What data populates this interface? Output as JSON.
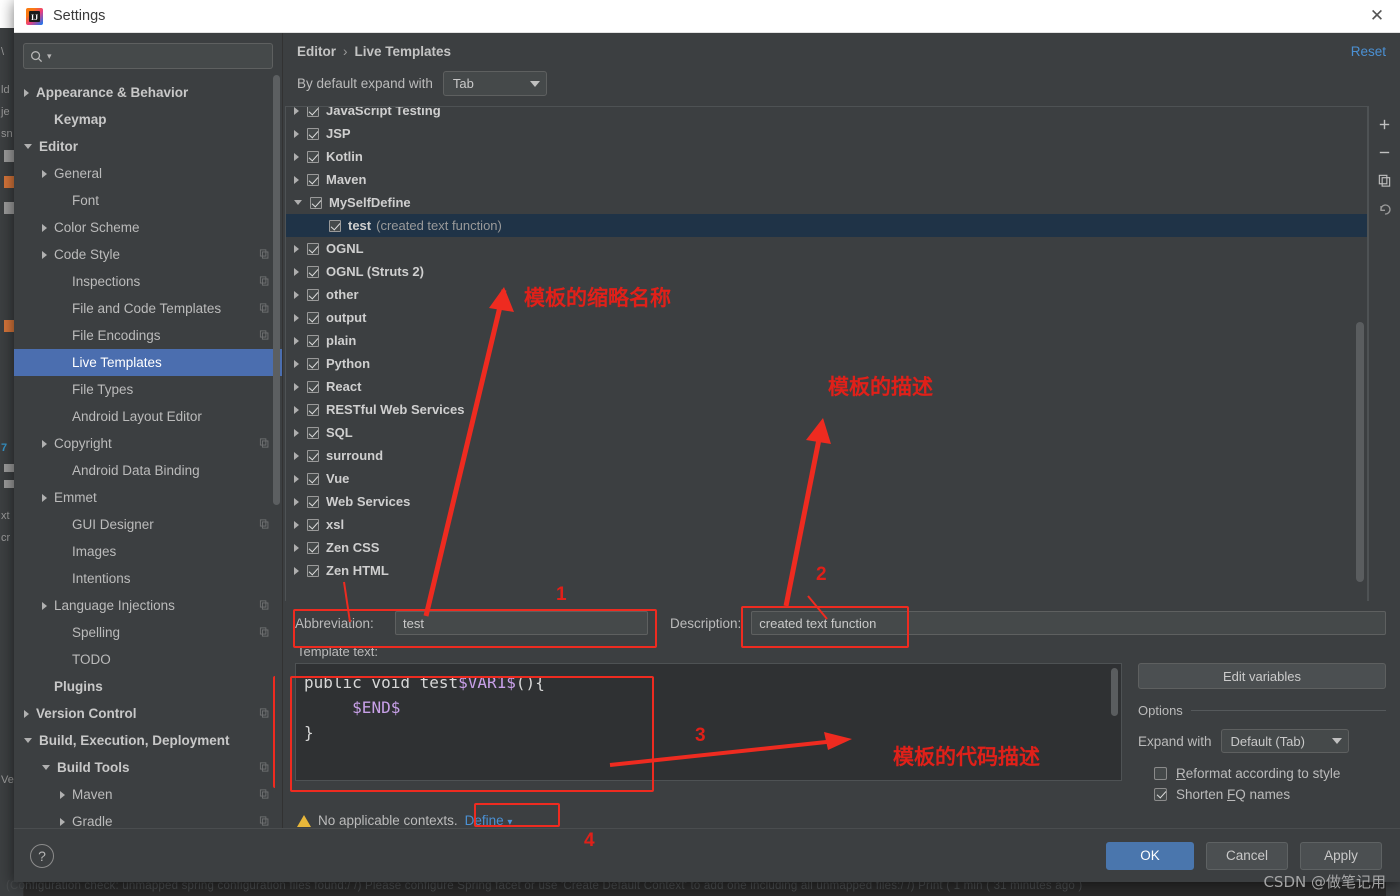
{
  "window": {
    "title": "Settings",
    "close_icon": "close-icon",
    "app_icon": "intellij-idea-logo"
  },
  "sidebar": {
    "search": {
      "value": "",
      "placeholder": "",
      "icon": "search-icon"
    },
    "items": [
      {
        "label": "Appearance & Behavior",
        "arrow": "right",
        "indent": 0,
        "bold": true,
        "copy": false,
        "selected": false
      },
      {
        "label": "Keymap",
        "arrow": "none",
        "indent": 1,
        "bold": true,
        "copy": false,
        "selected": false
      },
      {
        "label": "Editor",
        "arrow": "down",
        "indent": 0,
        "bold": true,
        "copy": false,
        "selected": false
      },
      {
        "label": "General",
        "arrow": "right",
        "indent": 1,
        "bold": false,
        "copy": false,
        "selected": false
      },
      {
        "label": "Font",
        "arrow": "none",
        "indent": 2,
        "bold": false,
        "copy": false,
        "selected": false
      },
      {
        "label": "Color Scheme",
        "arrow": "right",
        "indent": 1,
        "bold": false,
        "copy": false,
        "selected": false
      },
      {
        "label": "Code Style",
        "arrow": "right",
        "indent": 1,
        "bold": false,
        "copy": true,
        "selected": false
      },
      {
        "label": "Inspections",
        "arrow": "none",
        "indent": 2,
        "bold": false,
        "copy": true,
        "selected": false
      },
      {
        "label": "File and Code Templates",
        "arrow": "none",
        "indent": 2,
        "bold": false,
        "copy": true,
        "selected": false
      },
      {
        "label": "File Encodings",
        "arrow": "none",
        "indent": 2,
        "bold": false,
        "copy": true,
        "selected": false
      },
      {
        "label": "Live Templates",
        "arrow": "none",
        "indent": 2,
        "bold": false,
        "copy": false,
        "selected": true
      },
      {
        "label": "File Types",
        "arrow": "none",
        "indent": 2,
        "bold": false,
        "copy": false,
        "selected": false
      },
      {
        "label": "Android Layout Editor",
        "arrow": "none",
        "indent": 2,
        "bold": false,
        "copy": false,
        "selected": false
      },
      {
        "label": "Copyright",
        "arrow": "right",
        "indent": 1,
        "bold": false,
        "copy": true,
        "selected": false
      },
      {
        "label": "Android Data Binding",
        "arrow": "none",
        "indent": 2,
        "bold": false,
        "copy": false,
        "selected": false
      },
      {
        "label": "Emmet",
        "arrow": "right",
        "indent": 1,
        "bold": false,
        "copy": false,
        "selected": false
      },
      {
        "label": "GUI Designer",
        "arrow": "none",
        "indent": 2,
        "bold": false,
        "copy": true,
        "selected": false
      },
      {
        "label": "Images",
        "arrow": "none",
        "indent": 2,
        "bold": false,
        "copy": false,
        "selected": false
      },
      {
        "label": "Intentions",
        "arrow": "none",
        "indent": 2,
        "bold": false,
        "copy": false,
        "selected": false
      },
      {
        "label": "Language Injections",
        "arrow": "right",
        "indent": 1,
        "bold": false,
        "copy": true,
        "selected": false
      },
      {
        "label": "Spelling",
        "arrow": "none",
        "indent": 2,
        "bold": false,
        "copy": true,
        "selected": false
      },
      {
        "label": "TODO",
        "arrow": "none",
        "indent": 2,
        "bold": false,
        "copy": false,
        "selected": false
      },
      {
        "label": "Plugins",
        "arrow": "none",
        "indent": 1,
        "bold": true,
        "copy": false,
        "selected": false
      },
      {
        "label": "Version Control",
        "arrow": "right",
        "indent": 0,
        "bold": true,
        "copy": true,
        "selected": false
      },
      {
        "label": "Build, Execution, Deployment",
        "arrow": "down",
        "indent": 0,
        "bold": true,
        "copy": false,
        "selected": false
      },
      {
        "label": "Build Tools",
        "arrow": "down",
        "indent": 1,
        "bold": true,
        "copy": true,
        "selected": false
      },
      {
        "label": "Maven",
        "arrow": "right",
        "indent": 2,
        "bold": false,
        "copy": true,
        "selected": false
      },
      {
        "label": "Gradle",
        "arrow": "right",
        "indent": 2,
        "bold": false,
        "copy": true,
        "selected": false
      }
    ]
  },
  "main": {
    "breadcrumb": {
      "parent": "Editor",
      "separator": "›",
      "current": "Live Templates"
    },
    "reset_label": "Reset",
    "expand_with": {
      "label": "By default expand with",
      "value": "Tab"
    },
    "toolbar": [
      {
        "name": "add-template-button",
        "glyph": "+"
      },
      {
        "name": "remove-template-button",
        "glyph": "−"
      },
      {
        "name": "duplicate-template-button",
        "glyph": "copy"
      },
      {
        "name": "revert-template-button",
        "glyph": "undo"
      }
    ],
    "template_groups": [
      {
        "label": "JavaScript Testing",
        "arrow": "right",
        "child": false,
        "selected": false,
        "desc": ""
      },
      {
        "label": "JSP",
        "arrow": "right",
        "child": false,
        "selected": false,
        "desc": ""
      },
      {
        "label": "Kotlin",
        "arrow": "right",
        "child": false,
        "selected": false,
        "desc": ""
      },
      {
        "label": "Maven",
        "arrow": "right",
        "child": false,
        "selected": false,
        "desc": ""
      },
      {
        "label": "MySelfDefine",
        "arrow": "down",
        "child": false,
        "selected": false,
        "desc": ""
      },
      {
        "label": "test",
        "arrow": "none",
        "child": true,
        "selected": true,
        "desc": "(created text function)"
      },
      {
        "label": "OGNL",
        "arrow": "right",
        "child": false,
        "selected": false,
        "desc": ""
      },
      {
        "label": "OGNL (Struts 2)",
        "arrow": "right",
        "child": false,
        "selected": false,
        "desc": ""
      },
      {
        "label": "other",
        "arrow": "right",
        "child": false,
        "selected": false,
        "desc": ""
      },
      {
        "label": "output",
        "arrow": "right",
        "child": false,
        "selected": false,
        "desc": ""
      },
      {
        "label": "plain",
        "arrow": "right",
        "child": false,
        "selected": false,
        "desc": ""
      },
      {
        "label": "Python",
        "arrow": "right",
        "child": false,
        "selected": false,
        "desc": ""
      },
      {
        "label": "React",
        "arrow": "right",
        "child": false,
        "selected": false,
        "desc": ""
      },
      {
        "label": "RESTful Web Services",
        "arrow": "right",
        "child": false,
        "selected": false,
        "desc": ""
      },
      {
        "label": "SQL",
        "arrow": "right",
        "child": false,
        "selected": false,
        "desc": ""
      },
      {
        "label": "surround",
        "arrow": "right",
        "child": false,
        "selected": false,
        "desc": ""
      },
      {
        "label": "Vue",
        "arrow": "right",
        "child": false,
        "selected": false,
        "desc": ""
      },
      {
        "label": "Web Services",
        "arrow": "right",
        "child": false,
        "selected": false,
        "desc": ""
      },
      {
        "label": "xsl",
        "arrow": "right",
        "child": false,
        "selected": false,
        "desc": ""
      },
      {
        "label": "Zen CSS",
        "arrow": "right",
        "child": false,
        "selected": false,
        "desc": ""
      },
      {
        "label": "Zen HTML",
        "arrow": "right",
        "child": false,
        "selected": false,
        "desc": ""
      }
    ],
    "abbreviation": {
      "label": "Abbreviation:",
      "value": "test"
    },
    "description": {
      "label": "Description:",
      "value": "created text function"
    },
    "template_text_label": "Template text:",
    "code": {
      "line1_a": "public void test",
      "line1_var": "$VAR1$",
      "line1_b": "(){",
      "line2_var": "$END$",
      "line3": "}"
    },
    "options": {
      "edit_variables": "Edit variables",
      "title": "Options",
      "expand_with_label": "Expand with",
      "expand_with_value": "Default (Tab)",
      "reformat": {
        "label": "Reformat according to style",
        "checked": false
      },
      "shorten": {
        "label": "Shorten FQ names",
        "checked": true
      }
    },
    "context": {
      "warning": "No applicable contexts.",
      "define_label": "Define",
      "caret": "∨"
    }
  },
  "footer": {
    "help_label": "?",
    "ok": "OK",
    "cancel": "Cancel",
    "apply": "Apply"
  },
  "annotations": [
    {
      "id": "a1",
      "text": "模板的缩略名称"
    },
    {
      "id": "a2",
      "text": "模板的描述"
    },
    {
      "id": "a3",
      "text": "模板的代码描述"
    },
    {
      "id": "n1",
      "text": "1"
    },
    {
      "id": "n2",
      "text": "2"
    },
    {
      "id": "n3",
      "text": "3"
    },
    {
      "id": "n4",
      "text": "4"
    }
  ],
  "watermark": "CSDN @做笔记用",
  "background": {
    "bottom_text": "(Configuration check: unmapped spring configuration files found:/ /) Please configure Spring facet or use 'Create Default Context' to add one including all unmapped files:/ /) Print (  1 min ( 31 minutes ago )"
  },
  "colors": {
    "accent_blue": "#4b6eaf",
    "link_blue": "#4b90d3",
    "panel_bg": "#3c3f41",
    "annotation_red": "#ee2b20",
    "warn_yellow": "#e8b73a",
    "code_var_purple": "#c8a0e8"
  }
}
